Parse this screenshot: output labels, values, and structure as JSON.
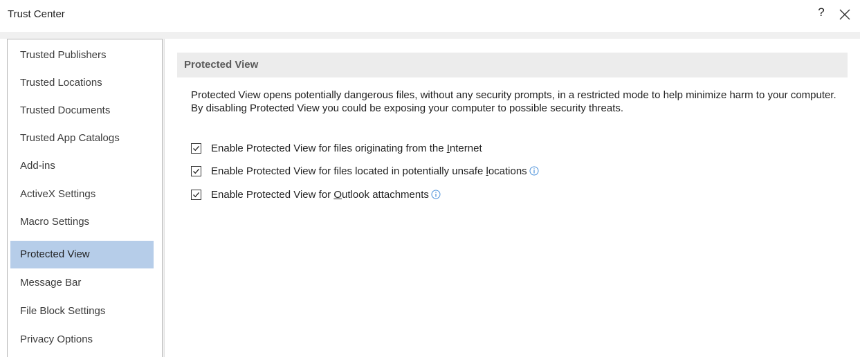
{
  "window": {
    "title": "Trust Center",
    "help_label": "?"
  },
  "sidebar": {
    "items": [
      {
        "label": "Trusted Publishers",
        "selected": false
      },
      {
        "label": "Trusted Locations",
        "selected": false
      },
      {
        "label": "Trusted Documents",
        "selected": false
      },
      {
        "label": "Trusted App Catalogs",
        "selected": false
      },
      {
        "label": "Add-ins",
        "selected": false
      },
      {
        "label": "ActiveX Settings",
        "selected": false
      },
      {
        "label": "Macro Settings",
        "selected": false
      },
      {
        "label": "Protected View",
        "selected": true
      },
      {
        "label": "Message Bar",
        "selected": false
      },
      {
        "label": "File Block Settings",
        "selected": false
      },
      {
        "label": "Privacy Options",
        "selected": false
      }
    ]
  },
  "main": {
    "section_title": "Protected View",
    "description": "Protected View opens potentially dangerous files, without any security prompts, in a restricted mode to help minimize harm to your computer. By disabling Protected View you could be exposing your computer to possible security threats.",
    "options": [
      {
        "pre": "Enable Protected View for files originating from the ",
        "accel": "I",
        "post": "nternet",
        "checked": true,
        "info": false
      },
      {
        "pre": "Enable Protected View for files located in potentially unsafe ",
        "accel": "l",
        "post": "ocations",
        "checked": true,
        "info": true
      },
      {
        "pre": "Enable Protected View for ",
        "accel": "O",
        "post": "utlook attachments",
        "checked": true,
        "info": true
      }
    ]
  },
  "colors": {
    "selected_bg": "#b6cde9",
    "info_icon": "#4a90d9",
    "header_bg": "#ececec"
  },
  "icons": {
    "help": "question-mark",
    "close": "close-icon",
    "checkbox": "checkmark-icon",
    "info": "info-icon"
  }
}
